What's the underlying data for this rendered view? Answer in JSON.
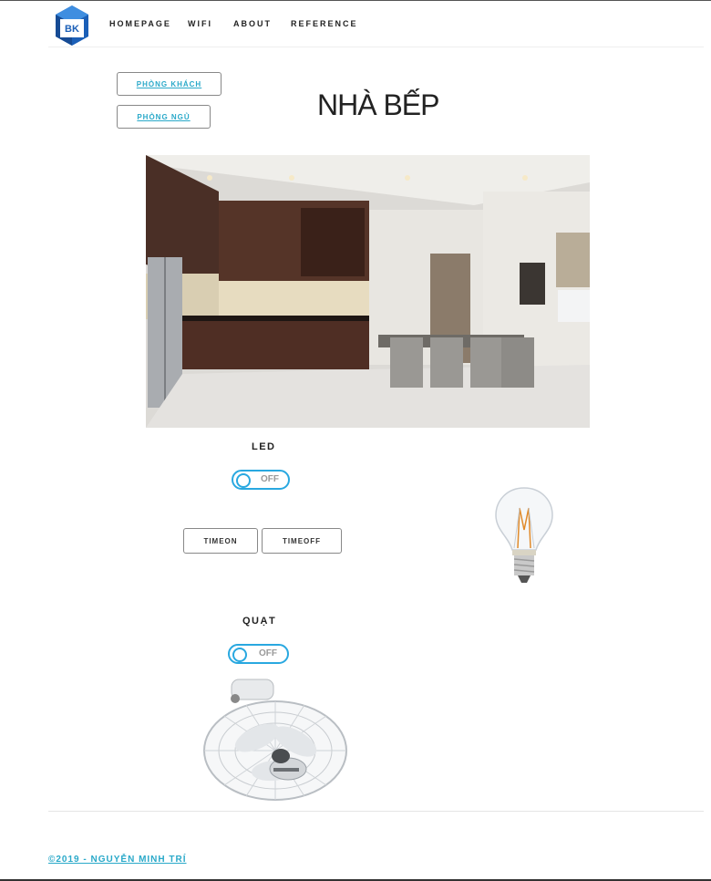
{
  "header": {
    "logo_text": "BK",
    "nav": [
      "HOMEPAGE",
      "WIFI",
      "ABOUT",
      "REFERENCE"
    ]
  },
  "rooms": [
    "PHÒNG KHÁCH",
    "PHÒNG NGỦ"
  ],
  "page_title": "NHÀ BẾP",
  "devices": {
    "led": {
      "label": "LED",
      "state": "OFF",
      "timeon": "TIMEON",
      "timeoff": "TIMEOFF"
    },
    "fan": {
      "label": "QUẠT",
      "state": "OFF"
    }
  },
  "footer": {
    "copyright": "©2019 - NGUYỄN MINH TRÍ"
  },
  "colors": {
    "accent": "#29a8e0",
    "link": "#2aa9c9",
    "logo_blue": "#1b5fb7"
  }
}
